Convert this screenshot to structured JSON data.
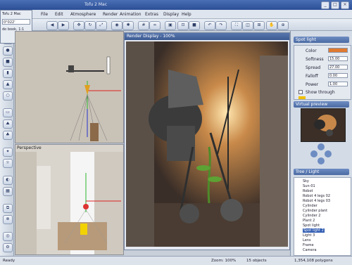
{
  "window": {
    "title": "Tofu 2 Mac",
    "left_box_value": "0°022'",
    "left_box_label": "do book, 1:1"
  },
  "menu": [
    "File",
    "Edit",
    "Atmosphere",
    "Render",
    "Animation",
    "Extras",
    "Display",
    "Help"
  ],
  "viewports": {
    "top_label": "",
    "bottom_label": "Perspective"
  },
  "render_window": {
    "title": "Render Display - 100%"
  },
  "properties": {
    "title": "Spot light",
    "rows": [
      {
        "label": "Color",
        "value": ""
      },
      {
        "label": "Softness",
        "value": "15.00"
      },
      {
        "label": "Spread",
        "value": "27.00"
      },
      {
        "label": "Falloff",
        "value": "0.00"
      },
      {
        "label": "Power",
        "value": "1.00"
      }
    ],
    "checkbox_label": "Show through"
  },
  "preview": {
    "title": "Virtual preview"
  },
  "tree": {
    "title": "Tree / Light",
    "items": [
      {
        "label": "Sky",
        "selected": false
      },
      {
        "label": "Sun-01",
        "selected": false
      },
      {
        "label": "Robot",
        "selected": false
      },
      {
        "label": "Robot 4 legs 02",
        "selected": false
      },
      {
        "label": "Robot 4 legs 03",
        "selected": false
      },
      {
        "label": "Cylinder",
        "selected": false
      },
      {
        "label": "Cylinder plant",
        "selected": false
      },
      {
        "label": "Cylinder 2",
        "selected": false
      },
      {
        "label": "Plant 2",
        "selected": false
      },
      {
        "label": "Spot light",
        "selected": false
      },
      {
        "label": "Spot light 2",
        "selected": true
      },
      {
        "label": "Light 3",
        "selected": false
      },
      {
        "label": "Lens",
        "selected": false
      },
      {
        "label": "Frame",
        "selected": false
      },
      {
        "label": "Camera",
        "selected": false
      }
    ]
  },
  "status": {
    "left": "Ready",
    "zoom": "Zoom: 100%",
    "objects": "15 objects",
    "polygons": "1,354,108 polygons"
  }
}
